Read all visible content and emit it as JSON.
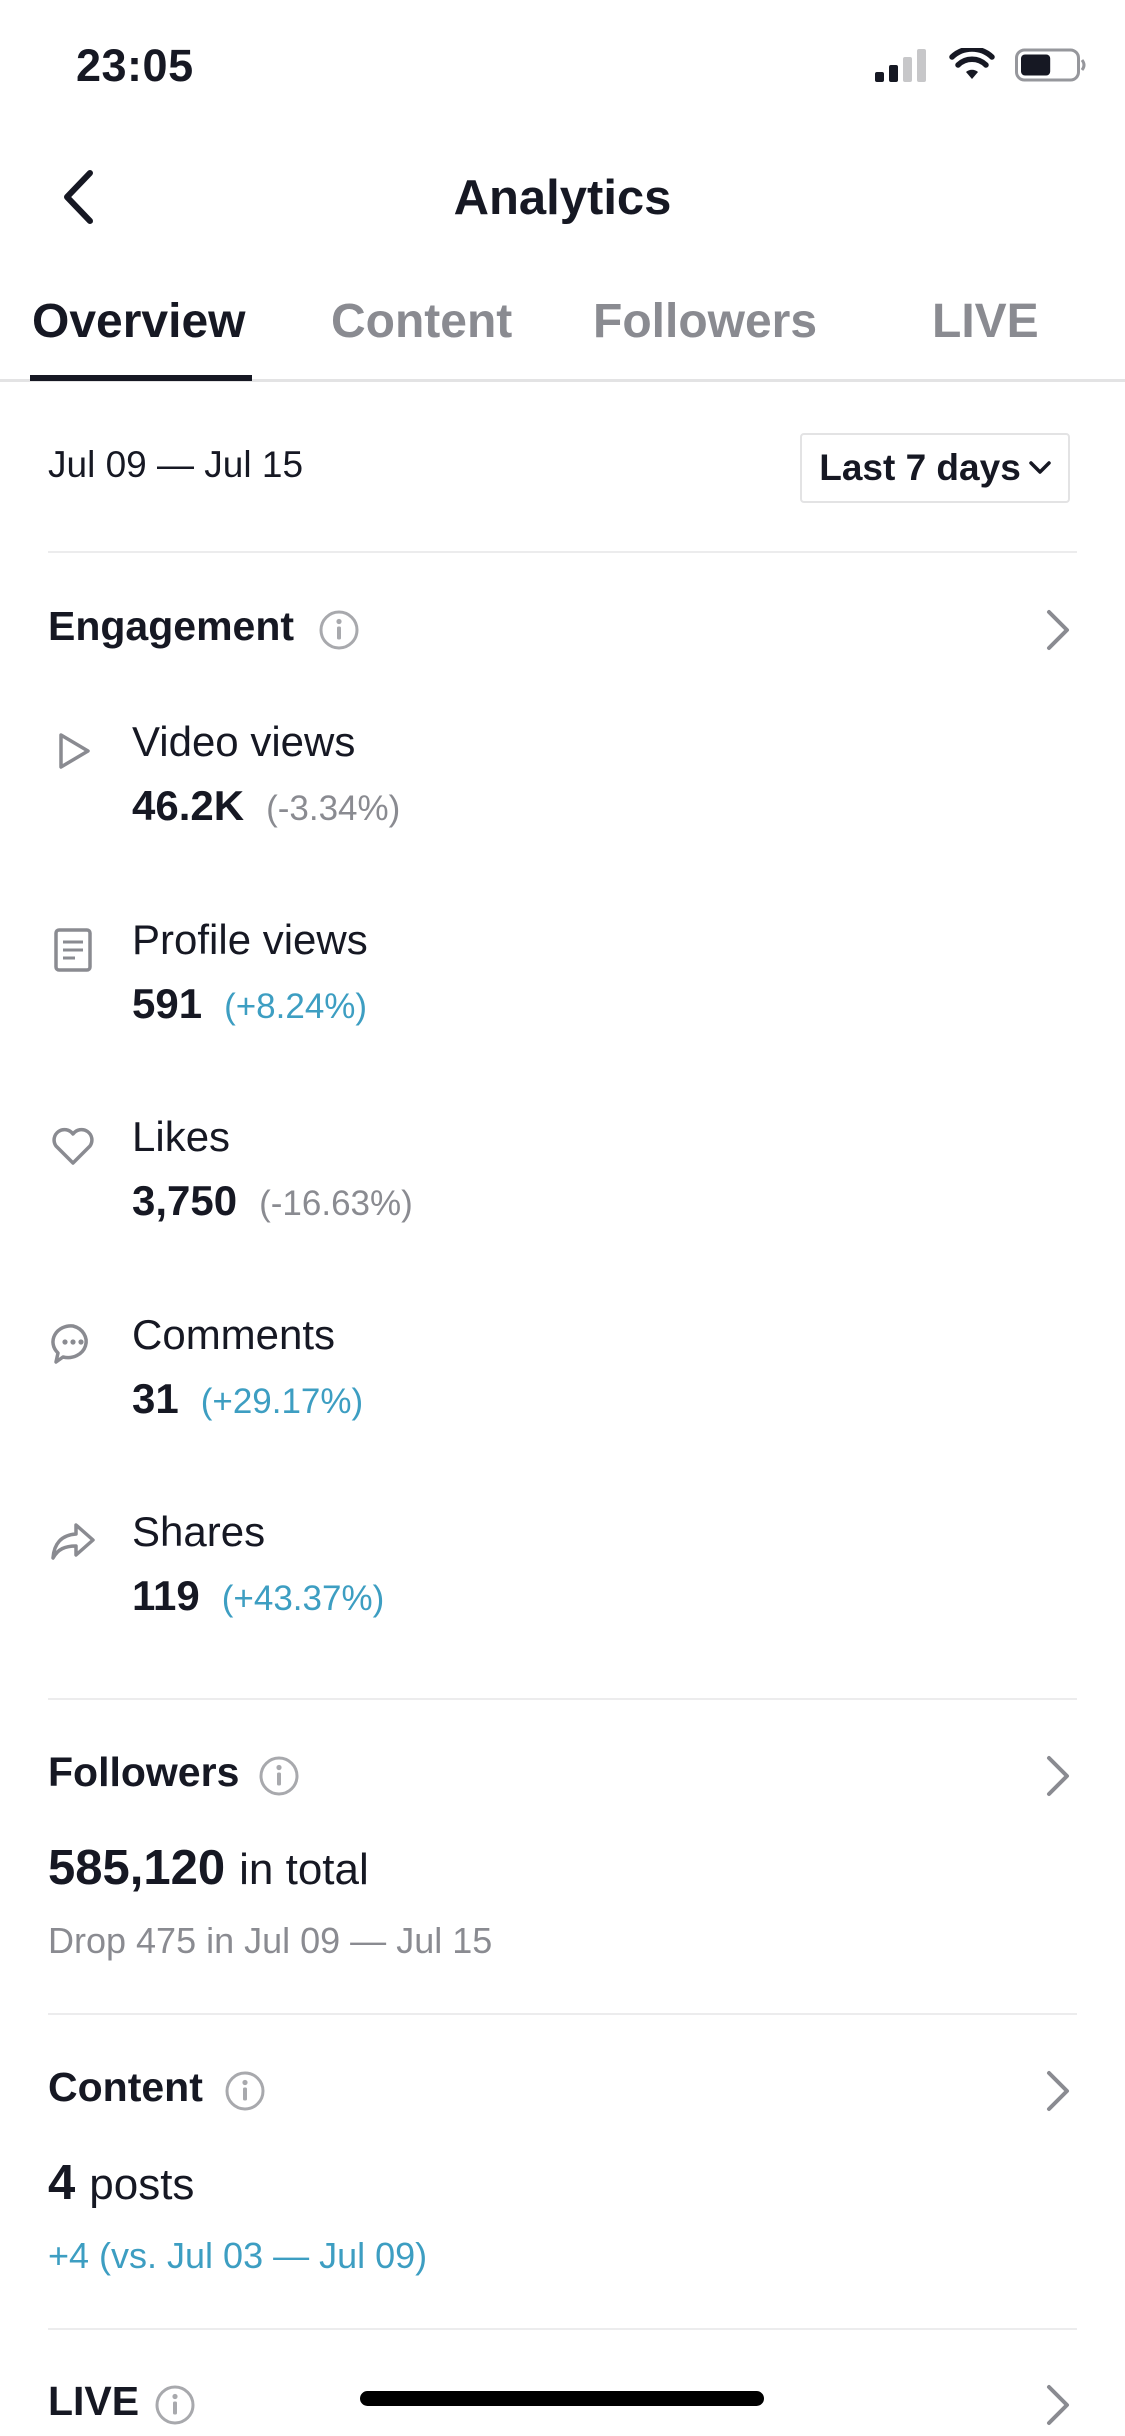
{
  "status_bar": {
    "time": "23:05",
    "battery_level": 0.55
  },
  "nav": {
    "title": "Analytics"
  },
  "tabs": [
    {
      "label": "Overview",
      "active": true
    },
    {
      "label": "Content",
      "active": false
    },
    {
      "label": "Followers",
      "active": false
    },
    {
      "label": "LIVE",
      "active": false
    }
  ],
  "date_range": "Jul 09 — Jul 15",
  "period_select": {
    "value": "Last 7 days"
  },
  "engagement": {
    "title": "Engagement",
    "metrics": [
      {
        "icon": "play-icon",
        "label": "Video views",
        "value": "46.2K",
        "change": "(-3.34%)",
        "trend": "down"
      },
      {
        "icon": "document-icon",
        "label": "Profile views",
        "value": "591",
        "change": "(+8.24%)",
        "trend": "up"
      },
      {
        "icon": "heart-icon",
        "label": "Likes",
        "value": "3,750",
        "change": "(-16.63%)",
        "trend": "down"
      },
      {
        "icon": "comment-icon",
        "label": "Comments",
        "value": "31",
        "change": "(+29.17%)",
        "trend": "up"
      },
      {
        "icon": "share-icon",
        "label": "Shares",
        "value": "119",
        "change": "(+43.37%)",
        "trend": "up"
      }
    ]
  },
  "followers": {
    "title": "Followers",
    "total": "585,120",
    "total_suffix": "in total",
    "note": "Drop 475 in Jul 09 — Jul 15"
  },
  "content": {
    "title": "Content",
    "count": "4",
    "count_suffix": "posts",
    "note": "+4 (vs. Jul 03 — Jul 09)"
  },
  "live": {
    "title": "LIVE"
  },
  "colors": {
    "text": "#161823",
    "muted": "#8a8b91",
    "positive": "#3d9ec2",
    "divider": "#ececed"
  }
}
